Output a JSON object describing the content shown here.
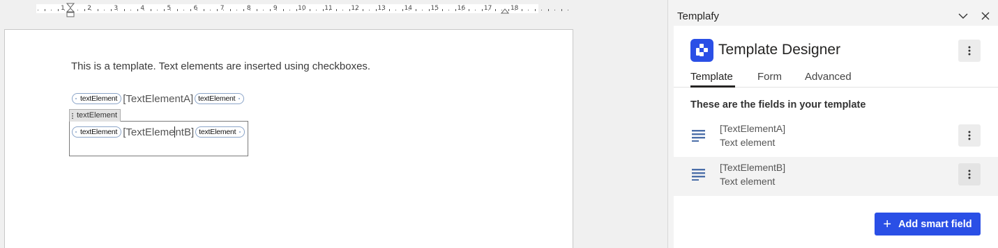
{
  "ruler": {
    "numbers": [
      "1",
      "2",
      "3",
      "4",
      "5",
      "6",
      "7",
      "8",
      "9",
      "10",
      "11",
      "12",
      "13",
      "14",
      "15",
      "16",
      "17",
      "18"
    ]
  },
  "document": {
    "intro_text": "This is a template. Text elements are inserted using checkboxes.",
    "control_a": {
      "tag_label": "textElement",
      "text": "[TextElementA]"
    },
    "control_b": {
      "title": "textElement",
      "tag_label": "textElement",
      "text_before_caret": "[TextEleme",
      "text_after_caret": "ntB]"
    }
  },
  "pane": {
    "title": "Templafy",
    "minimize_icon": "chevron-down-icon",
    "close_icon": "close-icon",
    "designer_title": "Template Designer",
    "tabs": [
      {
        "label": "Template",
        "active": true
      },
      {
        "label": "Form",
        "active": false
      },
      {
        "label": "Advanced",
        "active": false
      }
    ],
    "fields_heading": "These are the fields in your template",
    "fields": [
      {
        "name": "[TextElementA]",
        "type": "Text element",
        "selected": false
      },
      {
        "name": "[TextElementB]",
        "type": "Text element",
        "selected": true
      }
    ],
    "add_button": "Add smart field"
  },
  "colors": {
    "accent": "#2a4fe6",
    "field_icon": "#4b6ea8"
  }
}
